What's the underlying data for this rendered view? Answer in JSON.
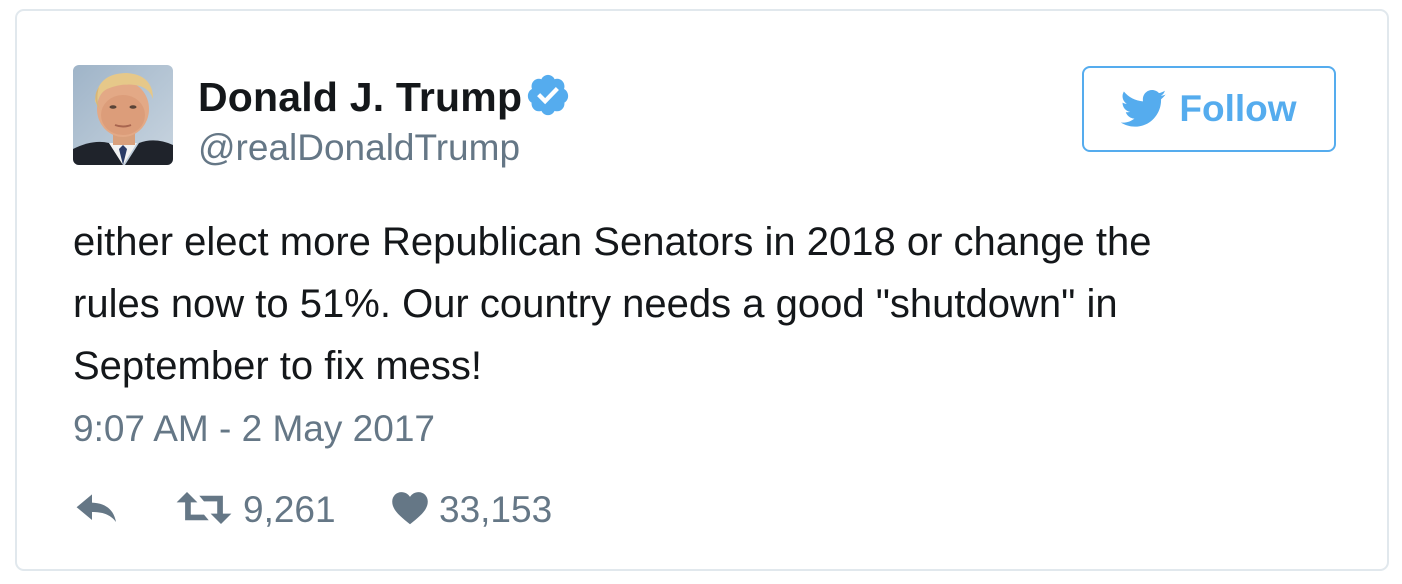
{
  "author": {
    "name": "Donald J. Trump",
    "handle": "@realDonaldTrump",
    "verified": true,
    "avatar_icon": "profile-photo"
  },
  "follow_button": {
    "label": "Follow",
    "icon": "twitter-bird-icon"
  },
  "tweet": {
    "text_lines": [
      "either elect more Republican Senators in 2018 or change the",
      "rules now to 51%. Our country needs a good \"shutdown\" in",
      "September to fix mess!"
    ],
    "timestamp": "9:07 AM - 2 May 2017"
  },
  "actions": {
    "reply_icon": "reply-icon",
    "retweet_icon": "retweet-icon",
    "retweet_count": "9,261",
    "like_icon": "heart-icon",
    "like_count": "33,153"
  },
  "colors": {
    "brand_blue": "#55acee",
    "verified_blue": "#1da1f2",
    "text_primary": "#14171a",
    "text_secondary": "#657786",
    "icon_gray": "#657786",
    "border": "#e1e8ed"
  }
}
